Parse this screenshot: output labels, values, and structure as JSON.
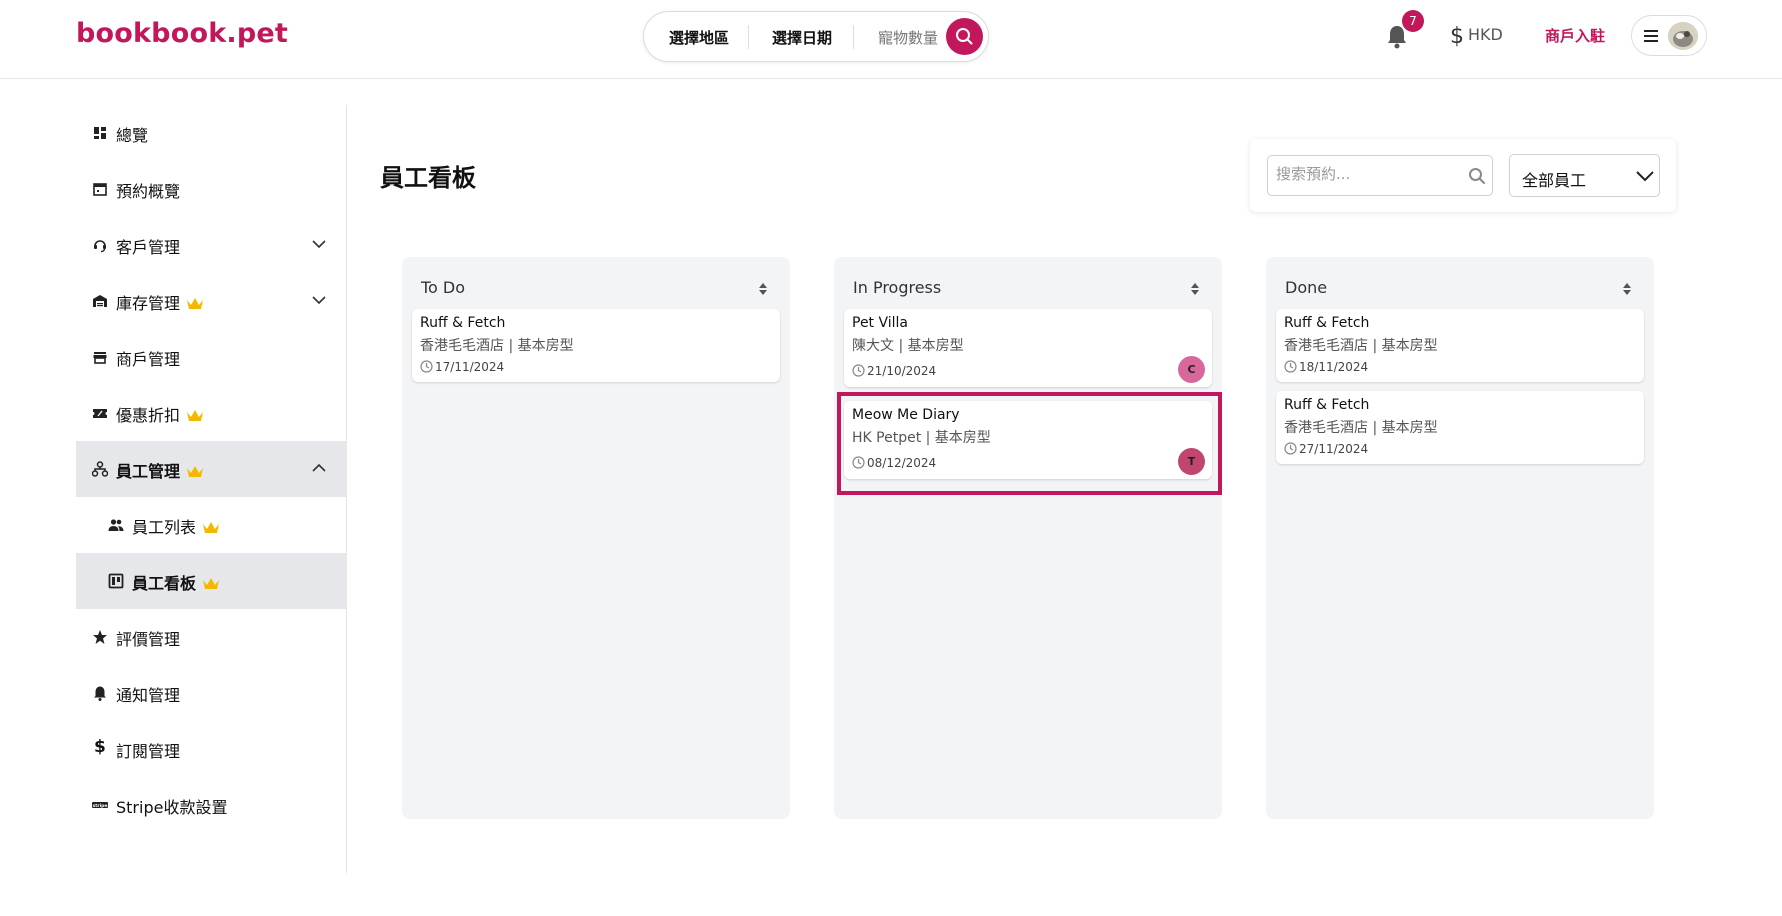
{
  "header": {
    "logo": "bookbook.pet",
    "search": {
      "region": "選擇地區",
      "date": "選擇日期",
      "pets": "寵物數量"
    },
    "notification_count": "7",
    "currency": "HKD",
    "merchant_link": "商戶入駐"
  },
  "sidebar": {
    "items": [
      {
        "label": "總覽"
      },
      {
        "label": "預約概覽"
      },
      {
        "label": "客戶管理"
      },
      {
        "label": "庫存管理"
      },
      {
        "label": "商戶管理"
      },
      {
        "label": "優惠折扣"
      },
      {
        "label": "員工管理"
      },
      {
        "label": "員工列表"
      },
      {
        "label": "員工看板"
      },
      {
        "label": "評價管理"
      },
      {
        "label": "通知管理"
      },
      {
        "label": "訂閱管理"
      },
      {
        "label": "Stripe收款設置"
      }
    ]
  },
  "main": {
    "title": "員工看板",
    "search_placeholder": "搜索預約...",
    "staff_filter": "全部員工",
    "columns": [
      {
        "title": "To Do",
        "cards": [
          {
            "name": "Ruff & Fetch",
            "sub": "香港毛毛酒店 | 基本房型",
            "date": "17/11/2024"
          }
        ]
      },
      {
        "title": "In Progress",
        "cards": [
          {
            "name": "Pet Villa",
            "sub": "陳大文 | 基本房型",
            "date": "21/10/2024",
            "assignee": "C"
          },
          {
            "name": "Meow Me Diary",
            "sub": "HK Petpet | 基本房型",
            "date": "08/12/2024",
            "assignee": "T"
          }
        ]
      },
      {
        "title": "Done",
        "cards": [
          {
            "name": "Ruff & Fetch",
            "sub": "香港毛毛酒店 | 基本房型",
            "date": "18/11/2024"
          },
          {
            "name": "Ruff & Fetch",
            "sub": "香港毛毛酒店 | 基本房型",
            "date": "27/11/2024"
          }
        ]
      }
    ]
  },
  "colors": {
    "brand": "#c2185b",
    "crown": "#f5b800",
    "assignee_c": "#d9689a",
    "assignee_t": "#c2456f"
  }
}
